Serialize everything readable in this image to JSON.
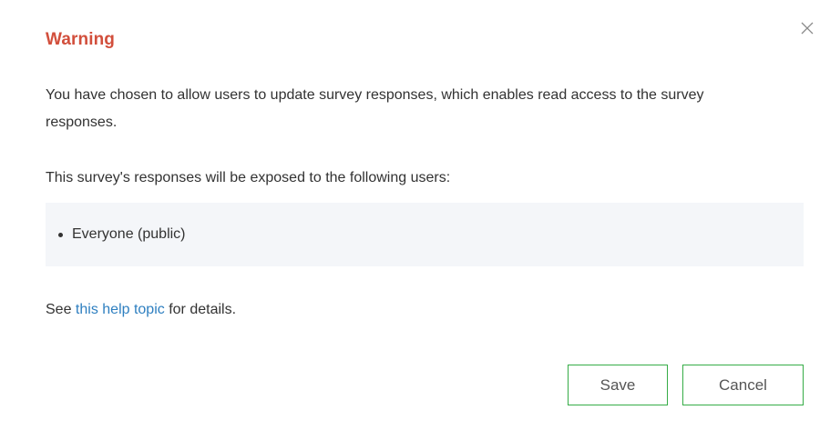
{
  "dialog": {
    "title": "Warning",
    "message": "You have chosen to allow users to update survey responses, which enables read access to the survey responses.",
    "exposure_text": "This survey's responses will be exposed to the following users:",
    "users": [
      "Everyone (public)"
    ],
    "help": {
      "prefix": "See ",
      "link_text": "this help topic",
      "suffix": " for details."
    },
    "buttons": {
      "save_label": "Save",
      "cancel_label": "Cancel"
    },
    "close_icon": "close-icon"
  },
  "colors": {
    "title": "#d24f3c",
    "link": "#2e7fc0",
    "button_border": "#35ac46",
    "list_background": "#f4f6f9"
  }
}
